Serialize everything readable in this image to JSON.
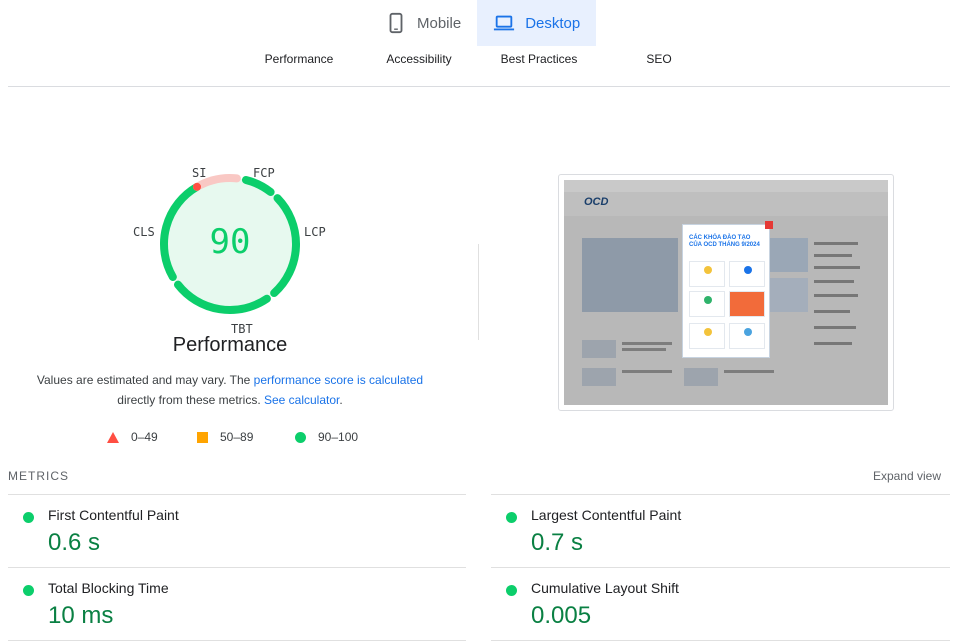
{
  "device_tabs": [
    {
      "label": "Mobile",
      "icon": "smartphone-icon",
      "active": false
    },
    {
      "label": "Desktop",
      "icon": "laptop-icon",
      "active": true
    }
  ],
  "category_tabs": [
    "Performance",
    "Accessibility",
    "Best Practices",
    "SEO"
  ],
  "gauge": {
    "score": "90",
    "title": "Performance",
    "segments": [
      "SI",
      "FCP",
      "LCP",
      "TBT",
      "CLS"
    ],
    "color_pass": "#0cce6b",
    "color_fail": "#ff4e42"
  },
  "note": {
    "text_before": "Values are estimated and may vary. The ",
    "link1": "performance score is calculated",
    "text_middle": " directly from these metrics. ",
    "link2": "See calculator",
    "text_after": "."
  },
  "legend": [
    {
      "range": "0–49",
      "icon": "triangle-icon",
      "color": "#ff4e42"
    },
    {
      "range": "50–89",
      "icon": "square-icon",
      "color": "#ffa400"
    },
    {
      "range": "90–100",
      "icon": "circle-icon",
      "color": "#0cce6b"
    }
  ],
  "screenshot": {
    "logo": "OCD",
    "popup_title": "CÁC KHÓA ĐÀO TẠO CỦA OCD THÁNG 9/2024"
  },
  "metrics": {
    "heading": "METRICS",
    "expand_label": "Expand view",
    "items": [
      {
        "name": "First Contentful Paint",
        "value": "0.6 s"
      },
      {
        "name": "Largest Contentful Paint",
        "value": "0.7 s"
      },
      {
        "name": "Total Blocking Time",
        "value": "10 ms"
      },
      {
        "name": "Cumulative Layout Shift",
        "value": "0.005"
      }
    ]
  }
}
